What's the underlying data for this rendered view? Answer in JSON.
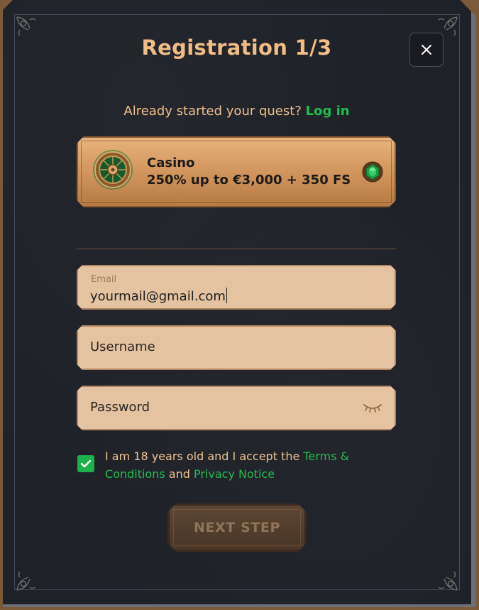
{
  "modal": {
    "title": "Registration 1/3",
    "close_icon": "close-icon"
  },
  "login_prompt": {
    "text": "Already started your quest?",
    "link": "Log in"
  },
  "bonus": {
    "name": "Casino",
    "offer": "250% up to €3,000 + 350 FS",
    "icon": "roulette-icon",
    "selected_icon": "emerald-gem-icon"
  },
  "form": {
    "email": {
      "label": "Email",
      "value": "yourmail@gmail.com"
    },
    "username": {
      "placeholder": "Username"
    },
    "password": {
      "placeholder": "Password",
      "toggle_icon": "eye-closed-icon"
    }
  },
  "consent": {
    "checked": true,
    "text_before": "I am 18 years old and I accept the",
    "terms_link": "Terms & Conditions",
    "text_and": "and",
    "privacy_link": "Privacy Notice"
  },
  "next_button": {
    "label": "NEXT STEP",
    "enabled": false
  },
  "colors": {
    "accent_gold": "#f2bd84",
    "link_green": "#1fbe4c",
    "background": "#1f2129",
    "field_bg": "#e5c3a0"
  }
}
